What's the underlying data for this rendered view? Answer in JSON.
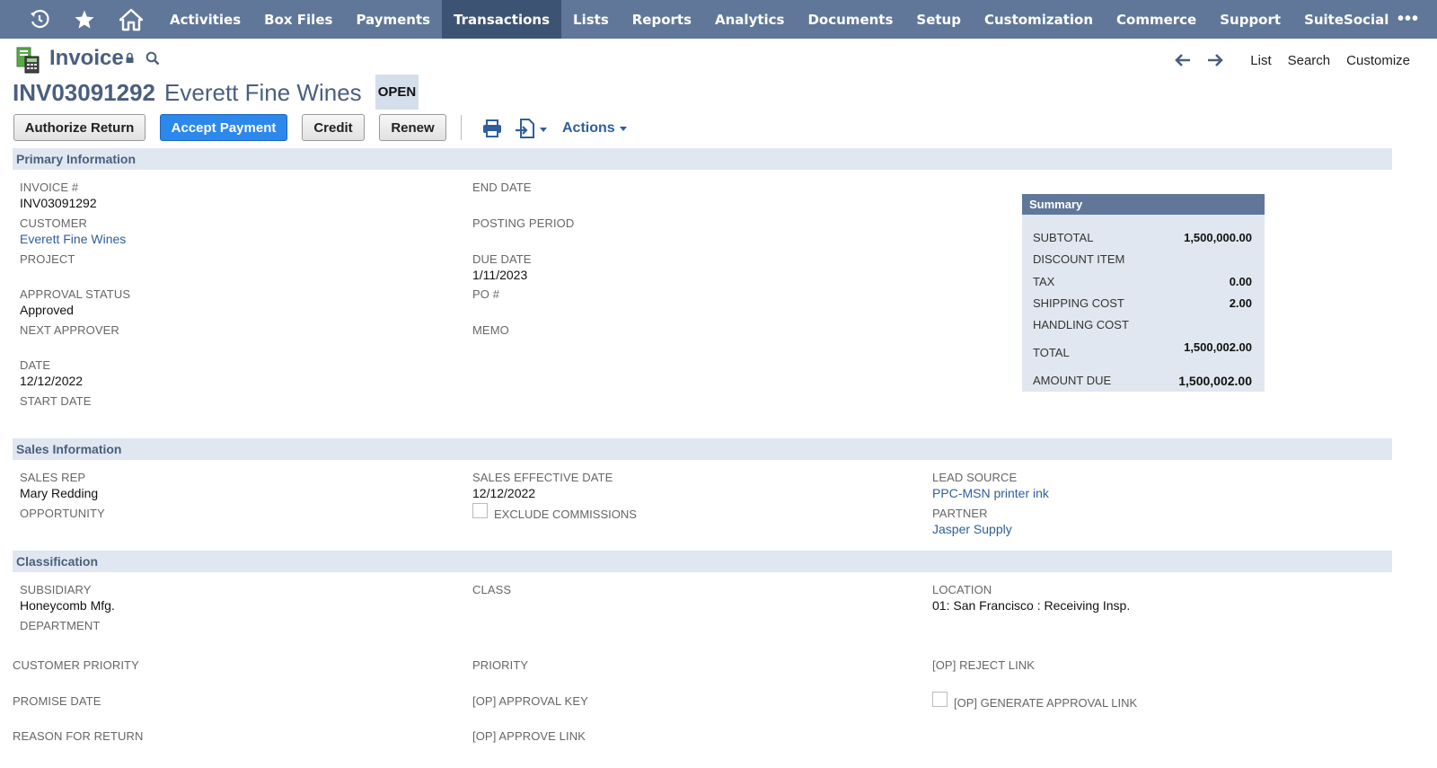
{
  "nav": {
    "items": [
      "Activities",
      "Box Files",
      "Payments",
      "Transactions",
      "Lists",
      "Reports",
      "Analytics",
      "Documents",
      "Setup",
      "Customization",
      "Commerce",
      "Support",
      "SuiteSocial"
    ],
    "active": "Transactions",
    "more": "•••",
    "icons": [
      "recent-records-icon",
      "star-icon",
      "home-icon"
    ],
    "bar_color": "#607799",
    "active_color": "#3c5373"
  },
  "header": {
    "record_type": "Invoice",
    "links": [
      "List",
      "Search",
      "Customize"
    ],
    "tranid": "INV03091292",
    "entity": "Everett Fine Wines",
    "status": "OPEN"
  },
  "buttons": {
    "authorize_return": "Authorize Return",
    "accept_payment": "Accept Payment",
    "credit": "Credit",
    "renew": "Renew",
    "actions": "Actions"
  },
  "sections": {
    "primary": "Primary Information",
    "sales": "Sales Information",
    "classification": "Classification"
  },
  "primary": {
    "invoice_no": {
      "label": "INVOICE #",
      "value": "INV03091292"
    },
    "customer": {
      "label": "CUSTOMER",
      "value": "Everett Fine Wines"
    },
    "project": {
      "label": "PROJECT"
    },
    "approval_status": {
      "label": "APPROVAL STATUS",
      "value": "Approved"
    },
    "next_approver": {
      "label": "NEXT APPROVER"
    },
    "date": {
      "label": "DATE",
      "value": "12/12/2022"
    },
    "start_date": {
      "label": "START DATE"
    },
    "end_date": {
      "label": "END DATE"
    },
    "posting_period": {
      "label": "POSTING PERIOD"
    },
    "due_date": {
      "label": "DUE DATE",
      "value": "1/11/2023"
    },
    "po": {
      "label": "PO #"
    },
    "memo": {
      "label": "MEMO"
    }
  },
  "summary": {
    "title": "Summary",
    "subtotal": {
      "label": "SUBTOTAL",
      "value": "1,500,000.00"
    },
    "discount": {
      "label": "DISCOUNT ITEM",
      "value": ""
    },
    "tax": {
      "label": "TAX",
      "value": "0.00"
    },
    "shipping": {
      "label": "SHIPPING COST",
      "value": "2.00"
    },
    "handling": {
      "label": "HANDLING COST",
      "value": ""
    },
    "total": {
      "label": "TOTAL",
      "value": "1,500,002.00"
    },
    "amount_due": {
      "label": "AMOUNT DUE",
      "value": "1,500,002.00"
    }
  },
  "sales": {
    "sales_rep": {
      "label": "SALES REP",
      "value": "Mary Redding"
    },
    "opportunity": {
      "label": "OPPORTUNITY"
    },
    "sales_effective_date": {
      "label": "SALES EFFECTIVE DATE",
      "value": "12/12/2022"
    },
    "exclude_commissions": {
      "label": "EXCLUDE COMMISSIONS"
    },
    "lead_source": {
      "label": "LEAD SOURCE",
      "value": "PPC-MSN printer ink"
    },
    "partner": {
      "label": "PARTNER",
      "value": "Jasper Supply"
    }
  },
  "classification": {
    "subsidiary": {
      "label": "SUBSIDIARY",
      "value": "Honeycomb Mfg."
    },
    "department": {
      "label": "DEPARTMENT"
    },
    "class": {
      "label": "CLASS"
    },
    "location": {
      "label": "LOCATION",
      "value": "01: San Francisco : Receiving Insp."
    }
  },
  "extra": {
    "customer_priority": "CUSTOMER PRIORITY",
    "promise_date": "PROMISE DATE",
    "reason_for_return": "REASON FOR RETURN",
    "priority": "PRIORITY",
    "approval_key": "[OP] APPROVAL KEY",
    "approve_link": "[OP] APPROVE LINK",
    "reject_link": "[OP] REJECT LINK",
    "generate_approval_link": "[OP] GENERATE APPROVAL LINK"
  }
}
